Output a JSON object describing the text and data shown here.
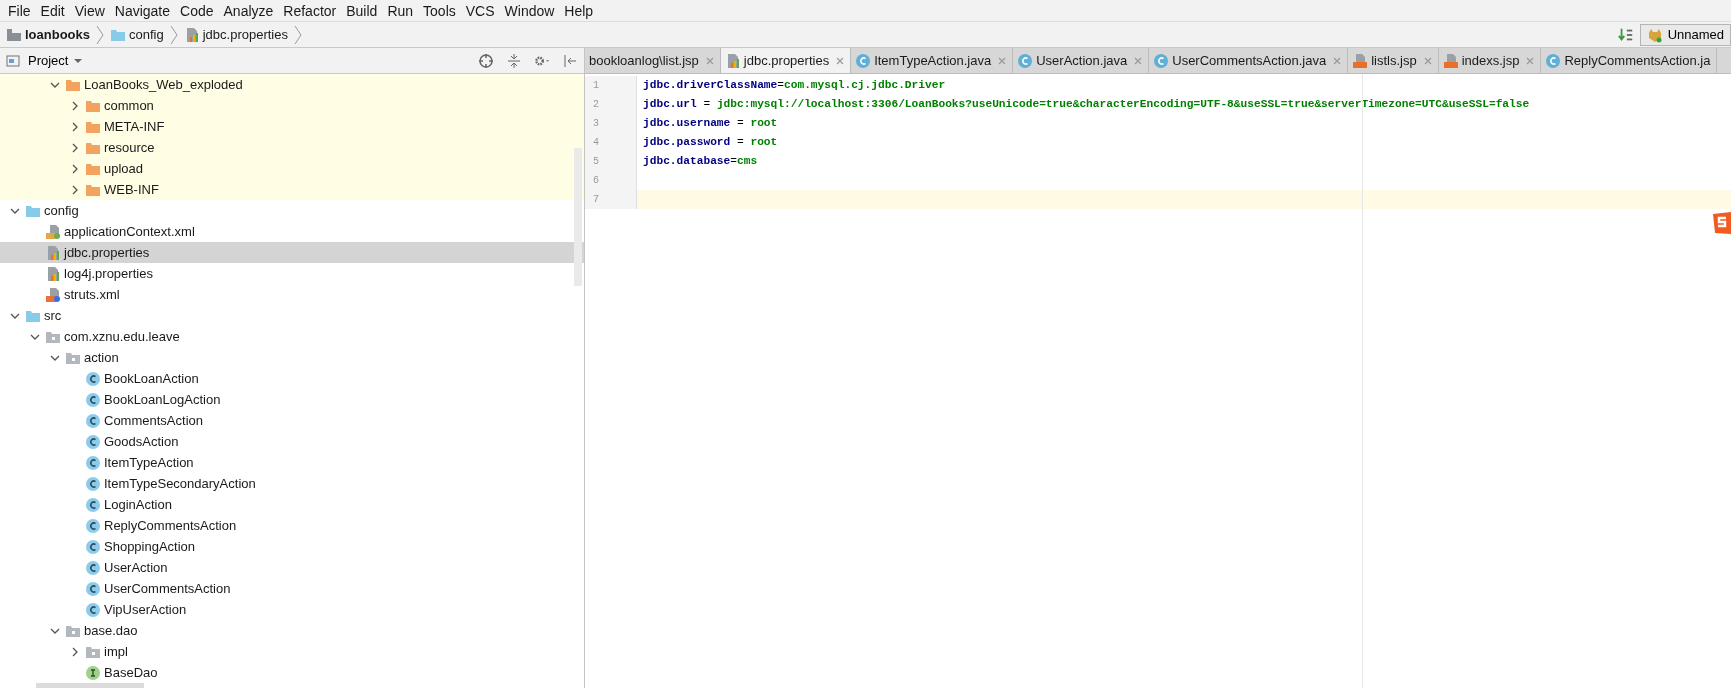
{
  "menu": [
    "File",
    "Edit",
    "View",
    "Navigate",
    "Code",
    "Analyze",
    "Refactor",
    "Build",
    "Run",
    "Tools",
    "VCS",
    "Window",
    "Help"
  ],
  "breadcrumbs": [
    {
      "label": "loanbooks",
      "kind": "module"
    },
    {
      "label": "config",
      "kind": "folder"
    },
    {
      "label": "jdbc.properties",
      "kind": "properties"
    }
  ],
  "run_config": {
    "label": "Unnamed"
  },
  "project_panel": {
    "title": "Project"
  },
  "tree": {
    "partial_branch": [
      {
        "label": "LoanBooks_Web_exploded",
        "kind": "web-folder",
        "excluded": true,
        "expanded": true,
        "selected": false,
        "children": [
          {
            "label": "common",
            "kind": "web-folder",
            "expanded": false,
            "selected": false
          },
          {
            "label": "META-INF",
            "kind": "web-folder",
            "expanded": false,
            "selected": false
          },
          {
            "label": "resource",
            "kind": "web-folder",
            "expanded": false,
            "selected": false
          },
          {
            "label": "upload",
            "kind": "web-folder",
            "expanded": false,
            "selected": false
          },
          {
            "label": "WEB-INF",
            "kind": "web-folder",
            "expanded": false,
            "selected": false
          }
        ]
      }
    ],
    "items": [
      {
        "label": "config",
        "kind": "source-folder",
        "expanded": true,
        "selected": false,
        "children": [
          {
            "label": "applicationContext.xml",
            "kind": "spring-xml",
            "selected": false
          },
          {
            "label": "jdbc.properties",
            "kind": "properties",
            "selected": true
          },
          {
            "label": "log4j.properties",
            "kind": "properties",
            "selected": false
          },
          {
            "label": "struts.xml",
            "kind": "struts-xml",
            "selected": false
          }
        ]
      },
      {
        "label": "src",
        "kind": "source-folder",
        "expanded": true,
        "selected": false,
        "children": [
          {
            "label": "com.xznu.edu.leave",
            "kind": "package",
            "expanded": true,
            "selected": false,
            "children": [
              {
                "label": "action",
                "kind": "package",
                "expanded": true,
                "selected": false,
                "children": [
                  {
                    "label": "BookLoanAction",
                    "kind": "class",
                    "selected": false
                  },
                  {
                    "label": "BookLoanLogAction",
                    "kind": "class",
                    "selected": false
                  },
                  {
                    "label": "CommentsAction",
                    "kind": "class",
                    "selected": false
                  },
                  {
                    "label": "GoodsAction",
                    "kind": "class",
                    "selected": false
                  },
                  {
                    "label": "ItemTypeAction",
                    "kind": "class",
                    "selected": false
                  },
                  {
                    "label": "ItemTypeSecondaryAction",
                    "kind": "class",
                    "selected": false
                  },
                  {
                    "label": "LoginAction",
                    "kind": "class",
                    "selected": false
                  },
                  {
                    "label": "ReplyCommentsAction",
                    "kind": "class",
                    "selected": false
                  },
                  {
                    "label": "ShoppingAction",
                    "kind": "class",
                    "selected": false
                  },
                  {
                    "label": "UserAction",
                    "kind": "class",
                    "selected": false
                  },
                  {
                    "label": "UserCommentsAction",
                    "kind": "class",
                    "selected": false
                  },
                  {
                    "label": "VipUserAction",
                    "kind": "class",
                    "selected": false
                  }
                ]
              },
              {
                "label": "base.dao",
                "kind": "package",
                "expanded": true,
                "selected": false,
                "children": [
                  {
                    "label": "impl",
                    "kind": "package",
                    "expanded": false,
                    "selected": false
                  },
                  {
                    "label": "BaseDao",
                    "kind": "interface",
                    "selected": false
                  }
                ]
              }
            ]
          }
        ]
      }
    ]
  },
  "tabs": [
    {
      "label": "bookloanlog\\list.jsp",
      "kind": "plain",
      "selected": false
    },
    {
      "label": "jdbc.properties",
      "kind": "properties",
      "selected": true
    },
    {
      "label": "ItemTypeAction.java",
      "kind": "class",
      "selected": false
    },
    {
      "label": "UserAction.java",
      "kind": "class",
      "selected": false
    },
    {
      "label": "UserCommentsAction.java",
      "kind": "class",
      "selected": false
    },
    {
      "label": "listls.jsp",
      "kind": "jsp",
      "selected": false
    },
    {
      "label": "indexs.jsp",
      "kind": "jsp",
      "selected": false
    },
    {
      "label": "ReplyCommentsAction.ja",
      "kind": "class",
      "selected": false
    }
  ],
  "editor": {
    "lines": [
      {
        "number": "1",
        "key": "jdbc.driverClassName",
        "separator": "=",
        "value": "com.mysql.cj.jdbc.Driver",
        "current": false
      },
      {
        "number": "2",
        "key": "jdbc.url",
        "separator": " = ",
        "value": "jdbc:mysql://localhost:3306/LoanBooks?useUnicode=true&characterEncoding=UTF-8&useSSL=true&serverTimezone=UTC&useSSL=false",
        "current": false
      },
      {
        "number": "3",
        "key": "jdbc.username",
        "separator": " = ",
        "value": "root",
        "current": false
      },
      {
        "number": "4",
        "key": "jdbc.password",
        "separator": " = ",
        "value": "root",
        "current": false
      },
      {
        "number": "5",
        "key": "jdbc.database",
        "separator": "=",
        "value": "cms",
        "current": false
      },
      {
        "number": "6",
        "current": false
      },
      {
        "number": "7",
        "current": true
      }
    ]
  }
}
